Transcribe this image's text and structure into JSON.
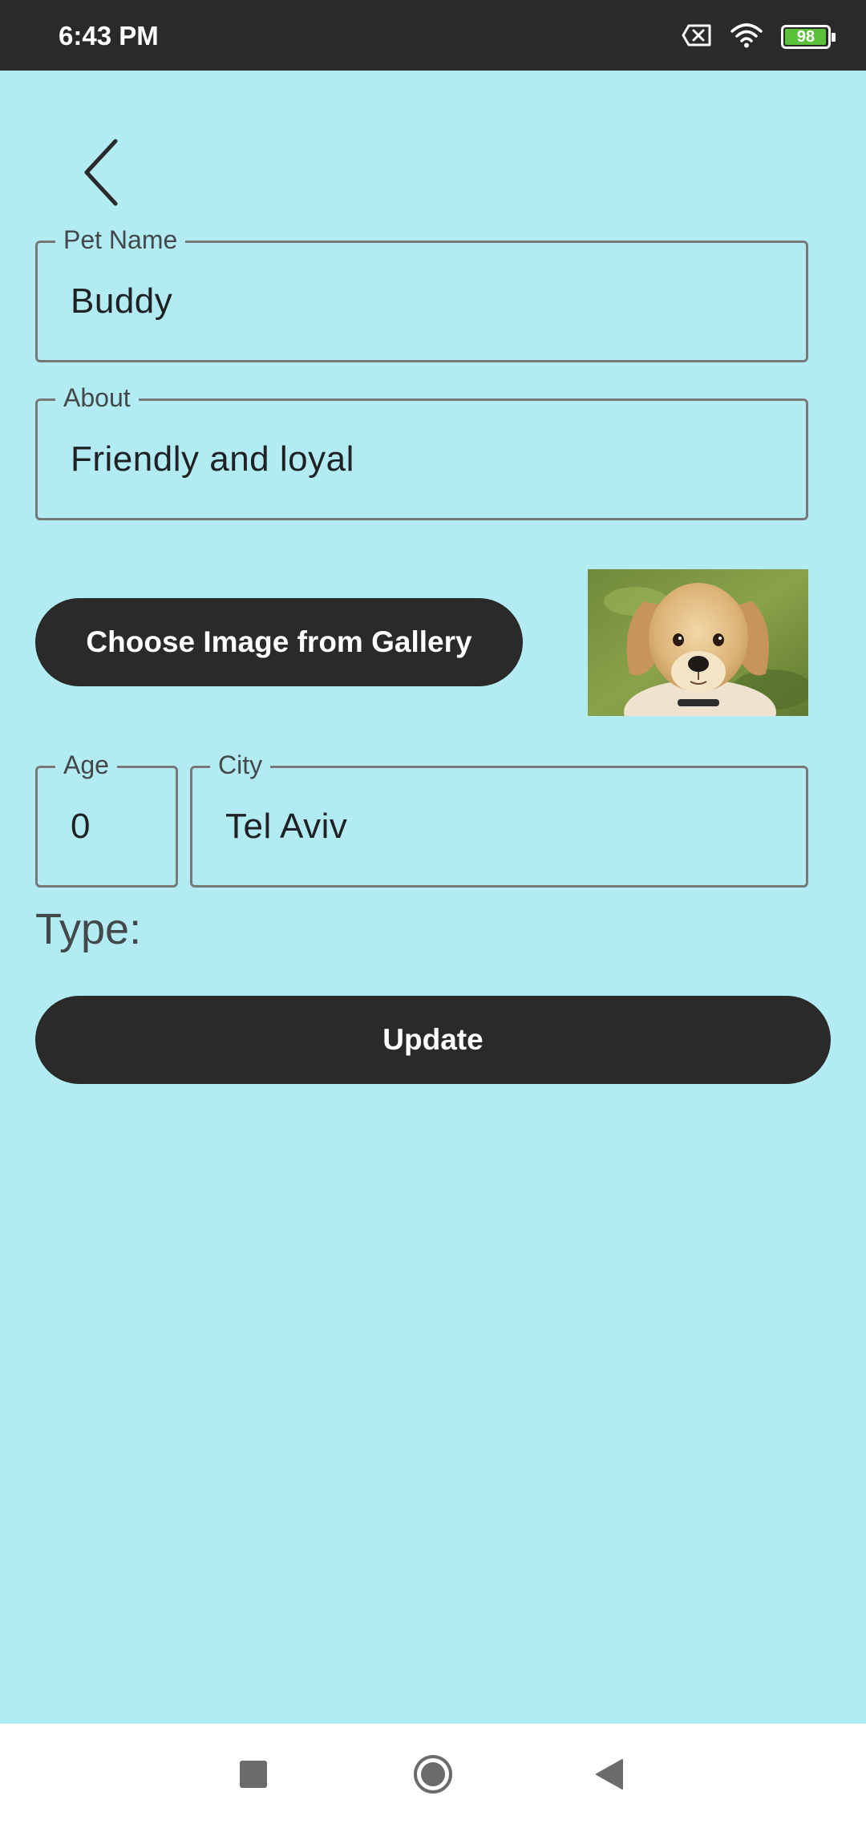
{
  "status_bar": {
    "time": "6:43 PM",
    "battery_level": 98,
    "battery_text": "98",
    "icons": [
      "sim-off-icon",
      "wifi-icon",
      "battery-icon"
    ]
  },
  "toolbar": {
    "back_icon": "chevron-left-icon"
  },
  "form": {
    "pet_name": {
      "label": "Pet Name",
      "value": "Buddy"
    },
    "about": {
      "label": "About",
      "value": "Friendly and loyal"
    },
    "choose_image_label": "Choose Image from Gallery",
    "age": {
      "label": "Age",
      "value": "0"
    },
    "city": {
      "label": "City",
      "value": "Tel Aviv"
    },
    "type_label": "Type:",
    "update_label": "Update"
  },
  "nav_bar": {
    "icons": [
      "recents-square-icon",
      "home-circle-icon",
      "back-triangle-icon"
    ]
  },
  "colors": {
    "background": "#b2ebf2",
    "button": "#2a2a2a",
    "status_bar": "#2a2a2a",
    "battery_fill": "#5cc13a"
  }
}
